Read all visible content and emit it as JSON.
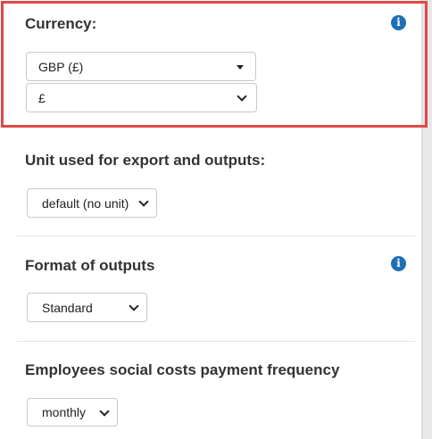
{
  "currency": {
    "title": "Currency:",
    "primary_select": "GBP (£)",
    "symbol_select": "£",
    "info_icon": "info-circle"
  },
  "unit": {
    "title": "Unit used for export and outputs:",
    "select_value": "default (no unit)"
  },
  "format": {
    "title": "Format of outputs",
    "select_value": "Standard",
    "info_icon": "info-circle"
  },
  "employees": {
    "title": "Employees social costs payment frequency",
    "select_value": "monthly"
  },
  "colors": {
    "highlight": "#e04848",
    "info": "#1f6fb5"
  }
}
